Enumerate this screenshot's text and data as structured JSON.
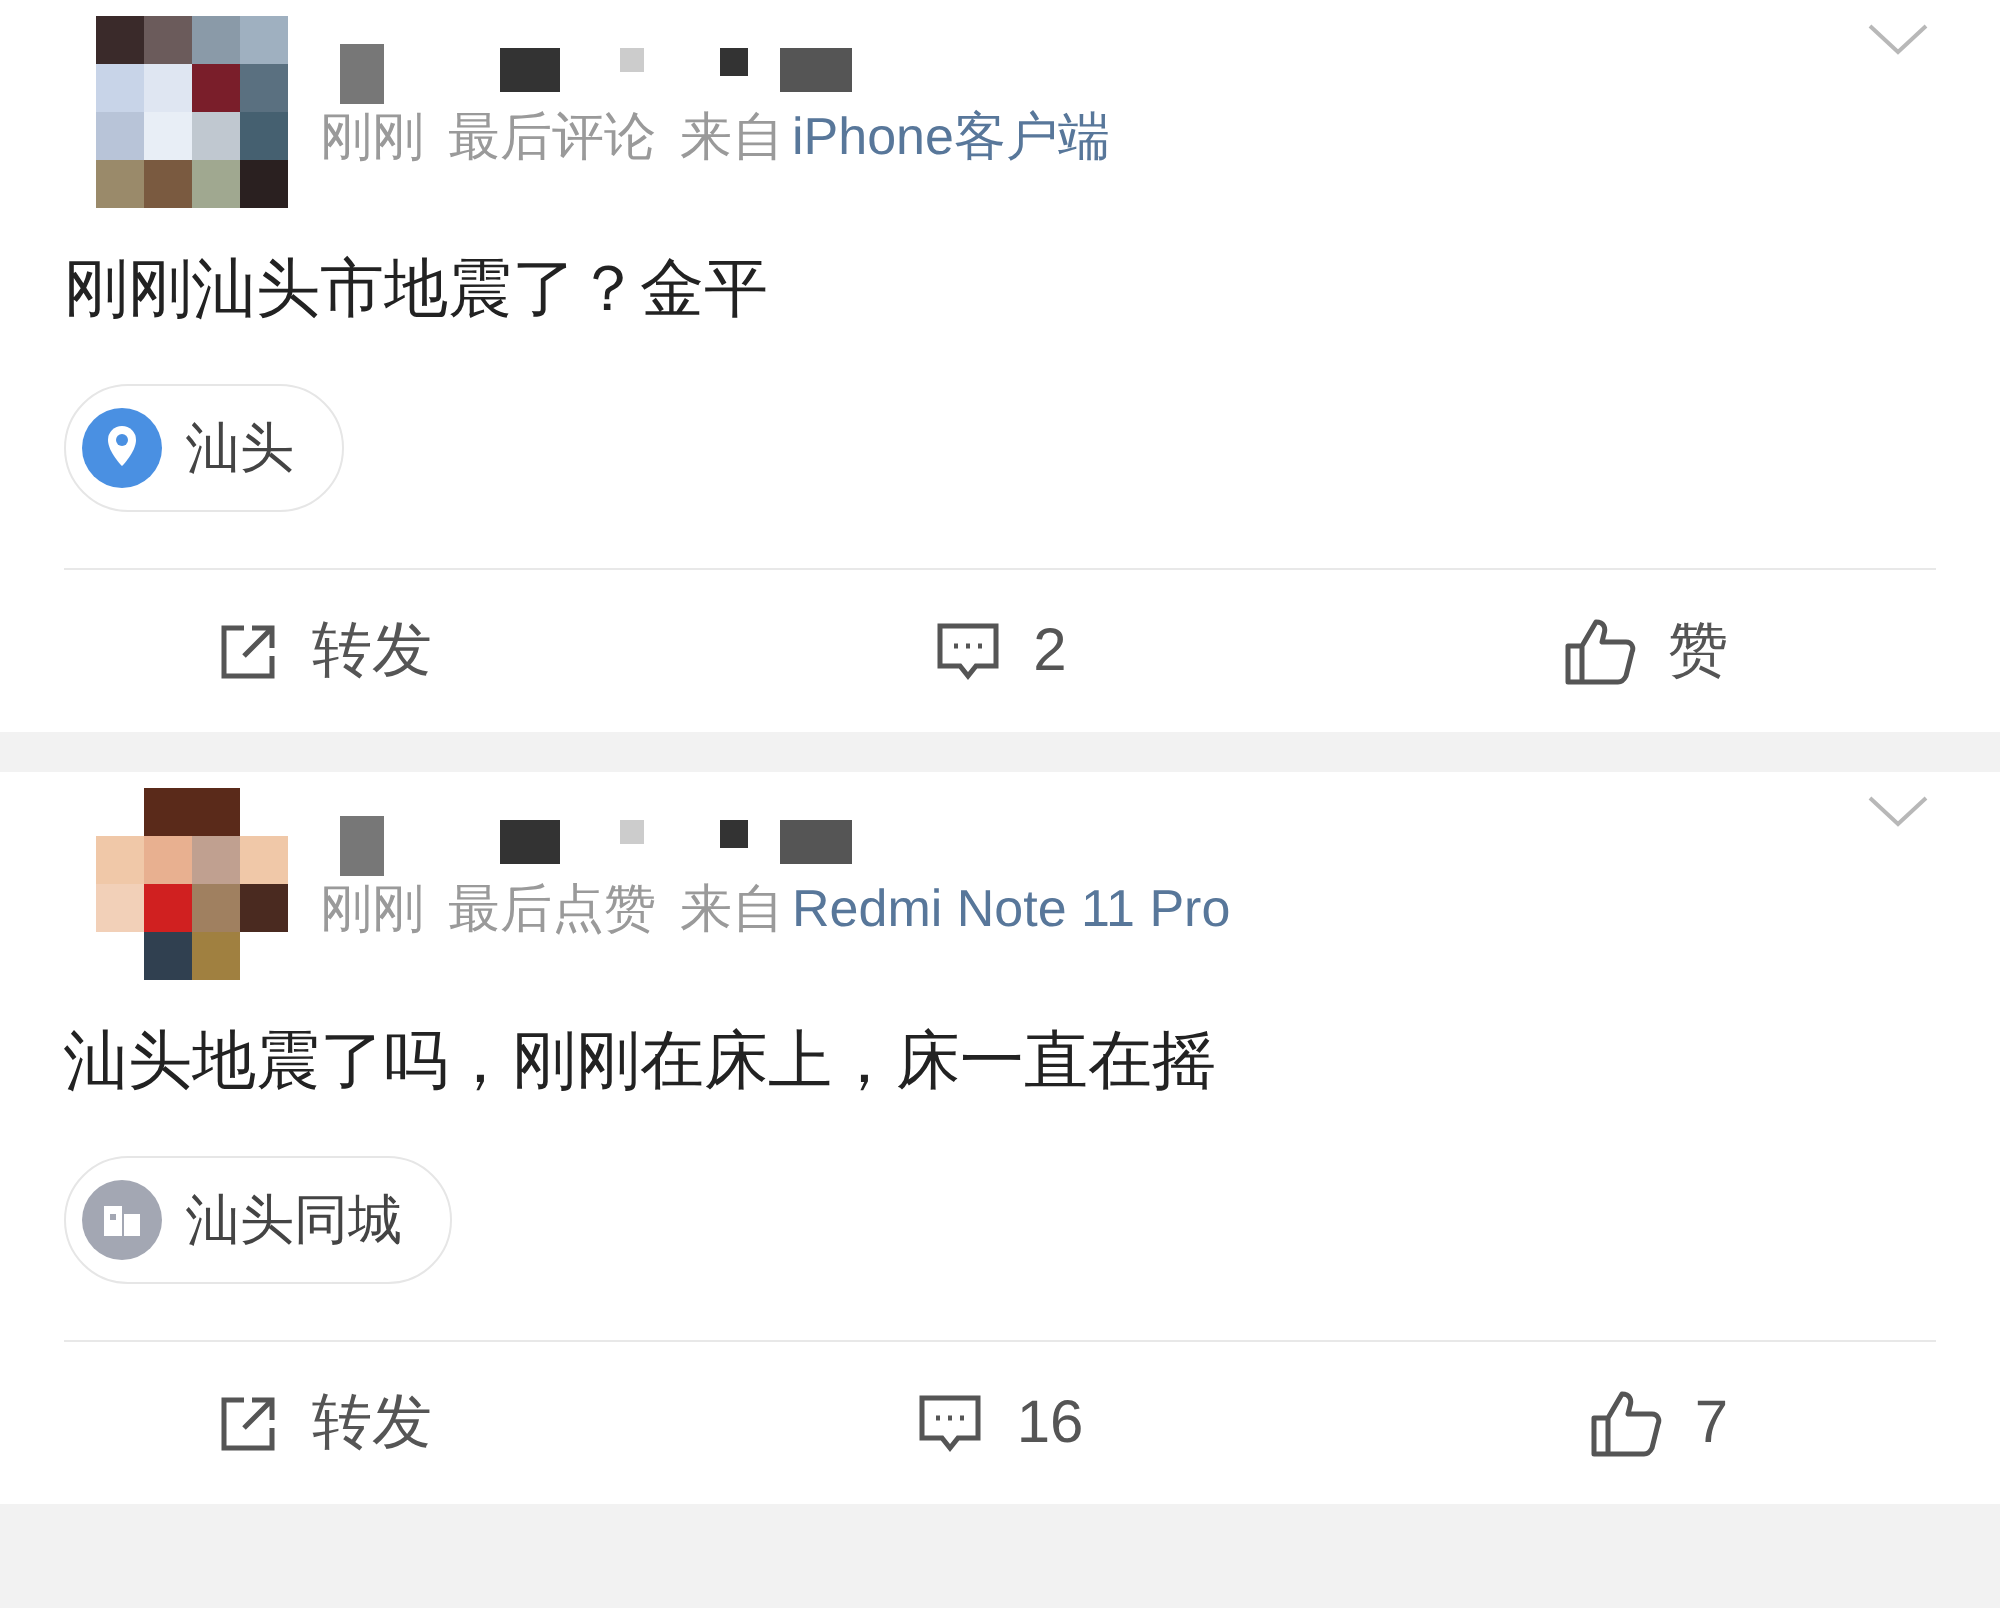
{
  "posts": [
    {
      "time": "刚刚",
      "activity": "最后评论",
      "source_prefix": "来自",
      "source": "iPhone客户端",
      "text": "刚刚汕头市地震了？金平",
      "tag": {
        "kind": "location",
        "label": "汕头"
      },
      "repost": "转发",
      "comments": "2",
      "likes": "赞"
    },
    {
      "time": "刚刚",
      "activity": "最后点赞",
      "source_prefix": "来自",
      "source": "Redmi Note 11 Pro",
      "text": "汕头地震了吗，刚刚在床上，床一直在摇",
      "tag": {
        "kind": "city",
        "label": "汕头同城"
      },
      "repost": "转发",
      "comments": "16",
      "likes": "7"
    }
  ]
}
